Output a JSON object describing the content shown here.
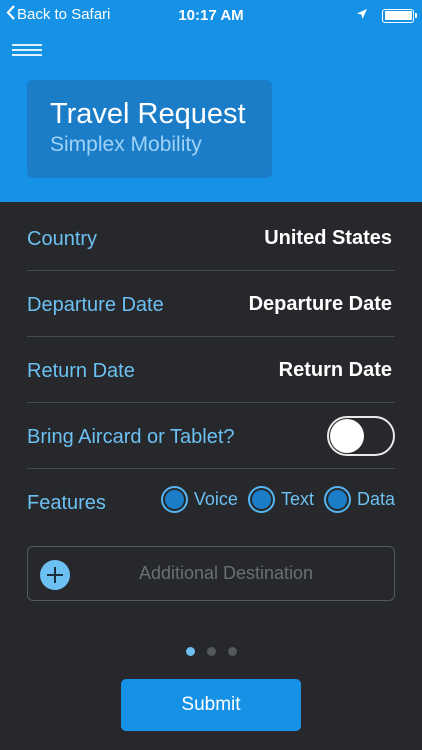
{
  "status_bar": {
    "back_label": "Back to Safari",
    "time": "10:17 AM",
    "battery_level": 1.0
  },
  "header": {
    "title": "Travel Request",
    "subtitle": "Simplex Mobility",
    "background_color": "#1592e6"
  },
  "form": {
    "country": {
      "label": "Country",
      "value": "United States"
    },
    "departure": {
      "label": "Departure Date",
      "value": "Departure Date"
    },
    "return": {
      "label": "Return Date",
      "value": "Return Date"
    },
    "aircard": {
      "label": "Bring Aircard or Tablet?",
      "checked": false
    },
    "features": {
      "label": "Features",
      "options": [
        "Voice",
        "Text",
        "Data"
      ]
    },
    "additional_destination": {
      "label": "Additional Destination"
    }
  },
  "pagination": {
    "pages": 3,
    "current": 1
  },
  "submit_label": "Submit",
  "icons": {
    "back": "chevron-left-icon",
    "location": "location-arrow-icon",
    "battery": "battery-icon",
    "menu": "hamburger-menu-icon",
    "add": "plus-circle-icon"
  }
}
